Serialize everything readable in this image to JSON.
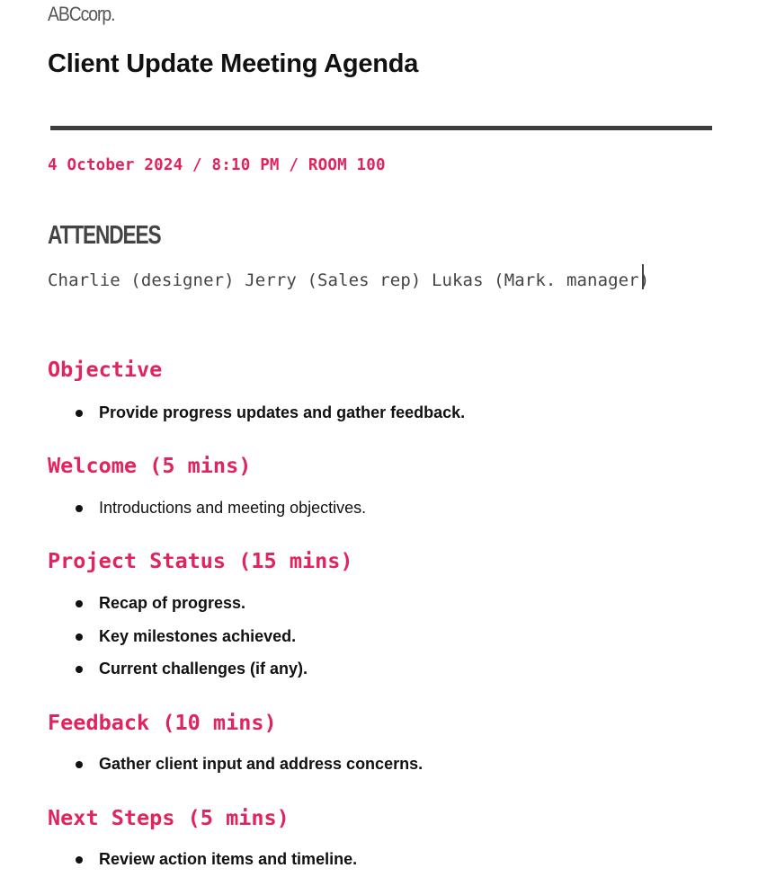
{
  "brand": "ABCcorp.",
  "title": "Client Update Meeting Agenda",
  "meta": "4 October 2024 / 8:10 PM / ROOM 100",
  "attendees": {
    "heading": "ATTENDEES",
    "text": "Charlie (designer) Jerry (Sales rep) Lukas (Mark. manager)"
  },
  "colors": {
    "accent": "#e0245e",
    "rule": "#3d3d3d",
    "body_text": "#111111",
    "muted_text": "#444444"
  },
  "sections": [
    {
      "heading": "Objective",
      "items": [
        "Provide progress updates and gather feedback."
      ],
      "bold": true
    },
    {
      "heading": "Welcome (5 mins)",
      "items": [
        "Introductions and meeting objectives."
      ],
      "bold": false
    },
    {
      "heading": "Project Status (15 mins)",
      "items": [
        "Recap of progress.",
        "Key milestones achieved.",
        "Current challenges (if any)."
      ],
      "bold": true
    },
    {
      "heading": "Feedback (10 mins)",
      "items": [
        "Gather client input and address concerns."
      ],
      "bold": true
    },
    {
      "heading": "Next Steps (5 mins)",
      "items": [
        "Review action items and timeline."
      ],
      "bold": true
    }
  ]
}
